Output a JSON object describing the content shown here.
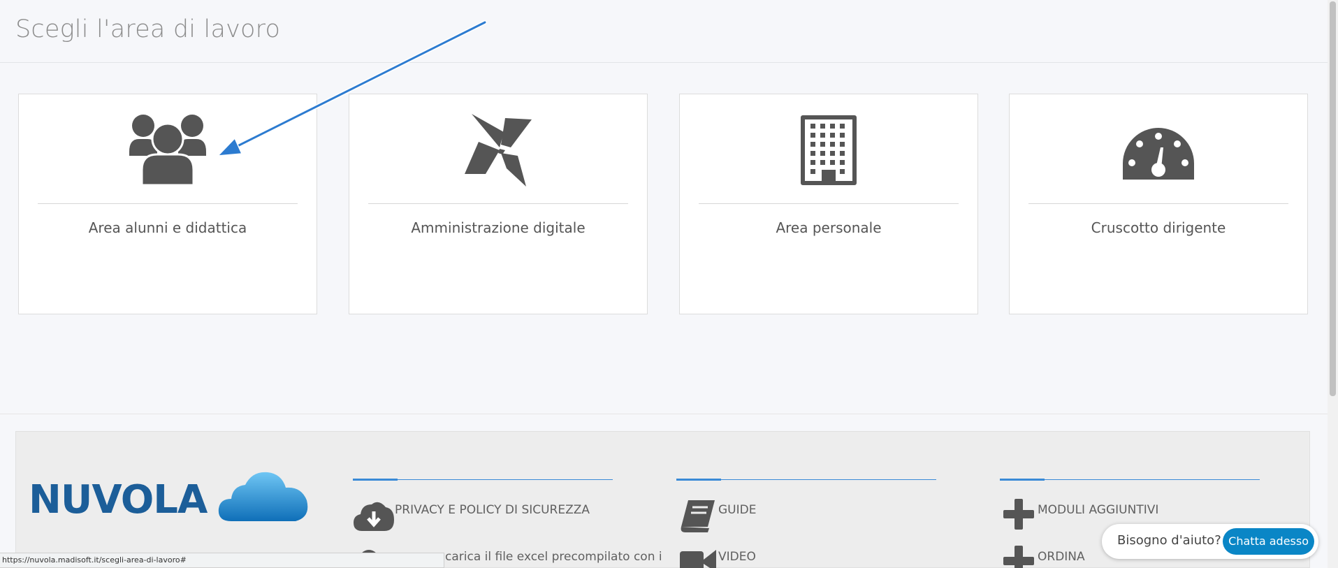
{
  "header": {
    "title": "Scegli l'area di lavoro"
  },
  "cards": [
    {
      "label": "Area alunni e didattica",
      "icon": "users-icon"
    },
    {
      "label": "Amministrazione digitale",
      "icon": "pinwheel-icon"
    },
    {
      "label": "Area personale",
      "icon": "building-icon"
    },
    {
      "label": "Cruscotto dirigente",
      "icon": "dashboard-icon"
    }
  ],
  "footer": {
    "logo_text": "NUVOLA",
    "columns": [
      {
        "links": [
          {
            "label": "PRIVACY E POLICY DI SICUREZZA",
            "icon": "cloud-download-icon"
          },
          {
            "label": "carica il file excel precompilato con i",
            "icon": "upload-icon"
          }
        ]
      },
      {
        "links": [
          {
            "label": "GUIDE",
            "icon": "book-icon"
          },
          {
            "label": "VIDEO",
            "icon": "video-camera-icon"
          }
        ]
      },
      {
        "links": [
          {
            "label": "MODULI AGGIUNTIVI",
            "icon": "plus-icon"
          },
          {
            "label": "ORDINA",
            "icon": "plus-icon"
          }
        ]
      }
    ]
  },
  "status_bar": {
    "url": "https://nuvola.madisoft.it/scegli-area-di-lavoro#"
  },
  "chat": {
    "prompt": "Bisogno d'aiuto?",
    "button": "Chatta adesso"
  },
  "colors": {
    "accent": "#3a8ad6",
    "chat_button": "#0a86c6",
    "logo": "#1c5e99",
    "icon": "#555555",
    "arrow": "#2c7bd0"
  }
}
